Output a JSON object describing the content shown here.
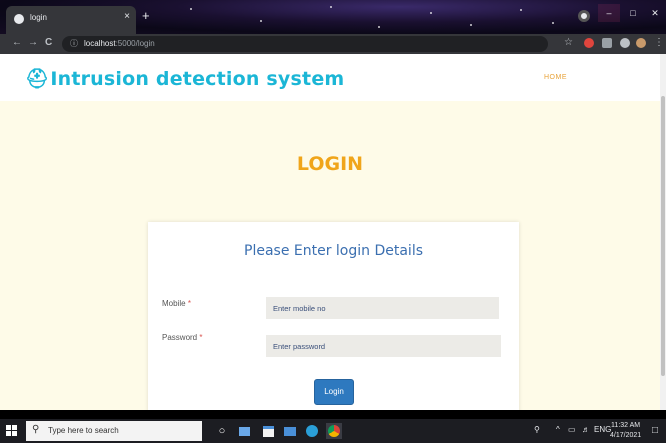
{
  "browser": {
    "tab_title": "login",
    "tab_close": "×",
    "new_tab": "+",
    "url_host": "localhost",
    "url_path": ":5000/login",
    "back": "←",
    "forward": "→",
    "reload": "C",
    "info_icon": "ⓘ",
    "min": "–",
    "max": "□",
    "close": "✕",
    "menu": "⋮",
    "star": "☆"
  },
  "site": {
    "brand_icon": "⛑",
    "brand": "Intrusion detection system",
    "nav_home": "HOME",
    "page_heading": "LOGIN"
  },
  "form": {
    "title": "Please Enter login Details",
    "mobile_label": "Mobile",
    "password_label": "Password",
    "required_mark": "*",
    "mobile_placeholder": "Enter mobile no",
    "password_placeholder": "Enter password",
    "submit": "Login"
  },
  "taskbar": {
    "search_placeholder": "Type here to search",
    "lang": "ENG",
    "time": "11:32 AM",
    "date": "4/17/2021"
  },
  "colors": {
    "brand": "#1bb6d6",
    "heading": "#f0a51a",
    "card_title": "#3b6fb0",
    "button": "#2e79bf",
    "page_bg": "#fefbe8"
  }
}
